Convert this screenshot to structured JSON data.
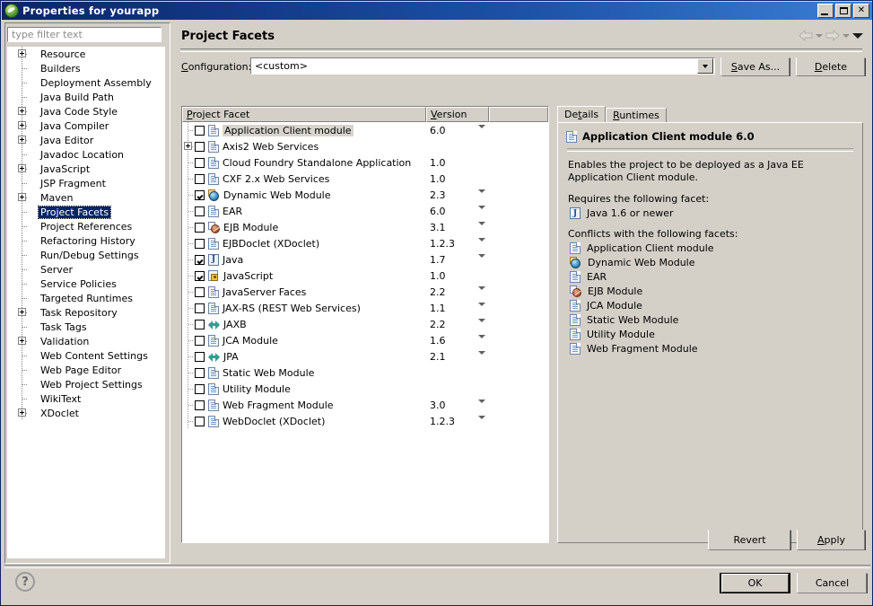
{
  "window": {
    "title": "Properties for yourapp",
    "icon": "eclipse-project-icon",
    "buttons": {
      "minimize": "minimize-button",
      "maximize": "maximize-button",
      "close": "close-button"
    }
  },
  "sidebar": {
    "filter_placeholder": "type filter text",
    "filter_value": "",
    "items": [
      {
        "label": "Resource",
        "expandable": true
      },
      {
        "label": "Builders",
        "expandable": false
      },
      {
        "label": "Deployment Assembly",
        "expandable": false
      },
      {
        "label": "Java Build Path",
        "expandable": false
      },
      {
        "label": "Java Code Style",
        "expandable": true
      },
      {
        "label": "Java Compiler",
        "expandable": true
      },
      {
        "label": "Java Editor",
        "expandable": true
      },
      {
        "label": "Javadoc Location",
        "expandable": false
      },
      {
        "label": "JavaScript",
        "expandable": true
      },
      {
        "label": "JSP Fragment",
        "expandable": false
      },
      {
        "label": "Maven",
        "expandable": true
      },
      {
        "label": "Project Facets",
        "expandable": false,
        "selected": true
      },
      {
        "label": "Project References",
        "expandable": false
      },
      {
        "label": "Refactoring History",
        "expandable": false
      },
      {
        "label": "Run/Debug Settings",
        "expandable": false
      },
      {
        "label": "Server",
        "expandable": false
      },
      {
        "label": "Service Policies",
        "expandable": false
      },
      {
        "label": "Targeted Runtimes",
        "expandable": false
      },
      {
        "label": "Task Repository",
        "expandable": true
      },
      {
        "label": "Task Tags",
        "expandable": false
      },
      {
        "label": "Validation",
        "expandable": true
      },
      {
        "label": "Web Content Settings",
        "expandable": false
      },
      {
        "label": "Web Page Editor",
        "expandable": false
      },
      {
        "label": "Web Project Settings",
        "expandable": false
      },
      {
        "label": "WikiText",
        "expandable": false
      },
      {
        "label": "XDoclet",
        "expandable": true
      }
    ]
  },
  "page": {
    "title": "Project Facets",
    "nav": {
      "back": "back-arrow-icon",
      "back_menu": "back-dropdown-icon",
      "forward": "forward-arrow-icon",
      "forward_menu": "forward-dropdown-icon",
      "menu": "view-menu-icon"
    }
  },
  "configuration": {
    "label": "Configuration:",
    "label_mnemonic": "C",
    "value": "<custom>",
    "save_as_label": "Save As...",
    "save_as_mnemonic": "S",
    "delete_label": "Delete",
    "delete_mnemonic": "D"
  },
  "facets_table": {
    "columns": [
      "Project Facet",
      "Version",
      ""
    ],
    "column_mnemonics": [
      "P",
      "V"
    ],
    "rows": [
      {
        "name": "Application Client module",
        "version": "6.0",
        "checked": false,
        "icon": "document-icon",
        "expandable": false,
        "has_version_menu": true,
        "selected": true
      },
      {
        "name": "Axis2 Web Services",
        "version": "",
        "checked": false,
        "icon": "document-icon",
        "expandable": true,
        "has_version_menu": false
      },
      {
        "name": "Cloud Foundry Standalone Application",
        "version": "1.0",
        "checked": false,
        "icon": "document-icon",
        "expandable": false,
        "has_version_menu": false
      },
      {
        "name": "CXF 2.x Web Services",
        "version": "1.0",
        "checked": false,
        "icon": "document-icon",
        "expandable": false,
        "has_version_menu": false
      },
      {
        "name": "Dynamic Web Module",
        "version": "2.3",
        "checked": true,
        "icon": "web-module-icon",
        "expandable": false,
        "has_version_menu": true
      },
      {
        "name": "EAR",
        "version": "6.0",
        "checked": false,
        "icon": "document-icon",
        "expandable": false,
        "has_version_menu": true
      },
      {
        "name": "EJB Module",
        "version": "3.1",
        "checked": false,
        "icon": "ejb-module-icon",
        "expandable": false,
        "has_version_menu": true
      },
      {
        "name": "EJBDoclet (XDoclet)",
        "version": "1.2.3",
        "checked": false,
        "icon": "document-icon",
        "expandable": false,
        "has_version_menu": true
      },
      {
        "name": "Java",
        "version": "1.7",
        "checked": true,
        "icon": "java-icon",
        "expandable": false,
        "has_version_menu": true
      },
      {
        "name": "JavaScript",
        "version": "1.0",
        "checked": true,
        "icon": "javascript-icon",
        "expandable": false,
        "has_version_menu": false
      },
      {
        "name": "JavaServer Faces",
        "version": "2.2",
        "checked": false,
        "icon": "document-icon",
        "expandable": false,
        "has_version_menu": true
      },
      {
        "name": "JAX-RS (REST Web Services)",
        "version": "1.1",
        "checked": false,
        "icon": "document-icon",
        "expandable": false,
        "has_version_menu": true
      },
      {
        "name": "JAXB",
        "version": "2.2",
        "checked": false,
        "icon": "jaxb-icon",
        "expandable": false,
        "has_version_menu": true
      },
      {
        "name": "JCA Module",
        "version": "1.6",
        "checked": false,
        "icon": "document-icon",
        "expandable": false,
        "has_version_menu": true
      },
      {
        "name": "JPA",
        "version": "2.1",
        "checked": false,
        "icon": "jaxb-icon",
        "expandable": false,
        "has_version_menu": true
      },
      {
        "name": "Static Web Module",
        "version": "",
        "checked": false,
        "icon": "document-icon",
        "expandable": false,
        "has_version_menu": false
      },
      {
        "name": "Utility Module",
        "version": "",
        "checked": false,
        "icon": "document-icon",
        "expandable": false,
        "has_version_menu": false
      },
      {
        "name": "Web Fragment Module",
        "version": "3.0",
        "checked": false,
        "icon": "document-icon",
        "expandable": false,
        "has_version_menu": true
      },
      {
        "name": "WebDoclet (XDoclet)",
        "version": "1.2.3",
        "checked": false,
        "icon": "document-icon",
        "expandable": false,
        "has_version_menu": true
      }
    ]
  },
  "details_panel": {
    "tabs": [
      {
        "label": "Details",
        "mnemonic": "t",
        "active": true
      },
      {
        "label": "Runtimes",
        "mnemonic": "R",
        "active": false
      }
    ],
    "heading": "Application Client module 6.0",
    "heading_icon": "document-icon",
    "description": "Enables the project to be deployed as a Java EE Application Client module.",
    "requires_label": "Requires the following facet:",
    "requires": [
      {
        "label": "Java 1.6 or newer",
        "icon": "java-icon"
      }
    ],
    "conflicts_label": "Conflicts with the following facets:",
    "conflicts": [
      {
        "label": "Application Client module",
        "icon": "document-icon"
      },
      {
        "label": "Dynamic Web Module",
        "icon": "web-module-icon"
      },
      {
        "label": "EAR",
        "icon": "document-icon"
      },
      {
        "label": "EJB Module",
        "icon": "ejb-module-icon"
      },
      {
        "label": "JCA Module",
        "icon": "document-icon"
      },
      {
        "label": "Static Web Module",
        "icon": "document-icon"
      },
      {
        "label": "Utility Module",
        "icon": "document-icon"
      },
      {
        "label": "Web Fragment Module",
        "icon": "document-icon"
      }
    ]
  },
  "actions": {
    "revert": "Revert",
    "apply": "Apply",
    "apply_mnemonic": "A",
    "ok": "OK",
    "cancel": "Cancel",
    "help": "?"
  }
}
